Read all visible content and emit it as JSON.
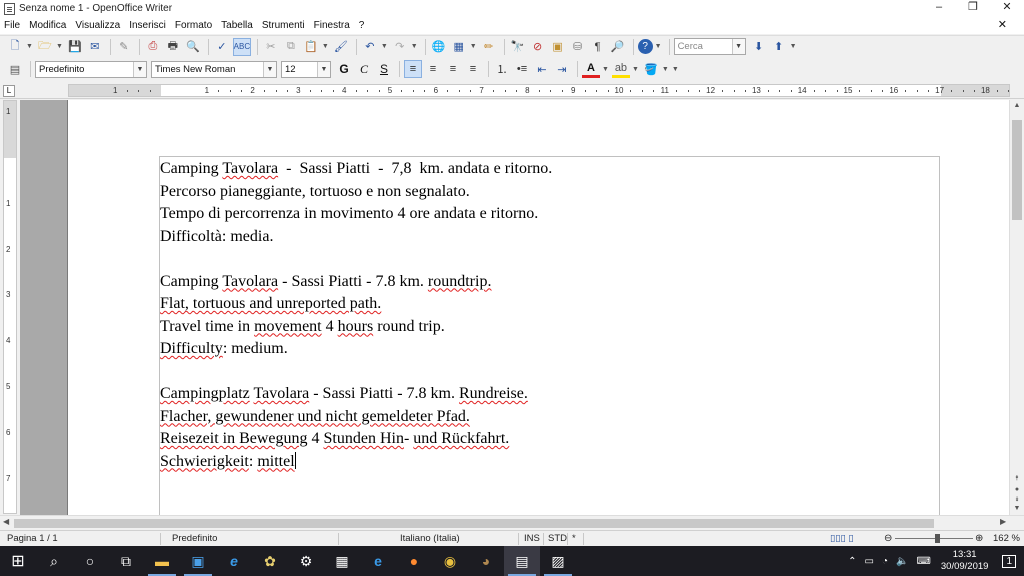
{
  "window": {
    "title": "Senza nome 1 - OpenOffice Writer",
    "minimize": "–",
    "maximize": "❐",
    "close": "✕"
  },
  "menu": [
    "File",
    "Modifica",
    "Visualizza",
    "Inserisci",
    "Formato",
    "Tabella",
    "Strumenti",
    "Finestra",
    "?"
  ],
  "toolbar": {
    "search_placeholder": "Cerca"
  },
  "formatting": {
    "style": "Predefinito",
    "font": "Times New Roman",
    "size": "12"
  },
  "ruler": {
    "h_ticks": [
      "1",
      "1",
      "2",
      "3",
      "4",
      "5",
      "6",
      "7",
      "8",
      "9",
      "10",
      "11",
      "12",
      "13",
      "14",
      "15",
      "16",
      "17",
      "18"
    ],
    "v_ticks": [
      "1",
      "1",
      "2",
      "3",
      "4",
      "5",
      "6",
      "7"
    ]
  },
  "document": {
    "lines": [
      [
        {
          "t": "Camping "
        },
        {
          "t": "Tavolara",
          "sp": true
        },
        {
          "t": "  -  Sassi Piatti  -  7,8  km. andata e ritorno."
        }
      ],
      [
        {
          "t": "Percorso pianeggiante, tortuoso e non segnalato."
        }
      ],
      [
        {
          "t": "Tempo di percorrenza in movimento 4 ore andata e ritorno."
        }
      ],
      [
        {
          "t": "Difficoltà: media."
        }
      ],
      [
        {
          "t": ""
        }
      ],
      [
        {
          "t": "Camping "
        },
        {
          "t": "Tavolara",
          "sp": true
        },
        {
          "t": " - Sassi Piatti - 7.8 km. "
        },
        {
          "t": "roundtrip.",
          "sp": true
        }
      ],
      [
        {
          "t": "Flat, tortuous and unreported path.",
          "sp": true
        }
      ],
      [
        {
          "t": "Travel time in "
        },
        {
          "t": "movement",
          "sp": true
        },
        {
          "t": " 4 "
        },
        {
          "t": "hours",
          "sp": true
        },
        {
          "t": " round trip."
        }
      ],
      [
        {
          "t": "Difficulty",
          "sp": true
        },
        {
          "t": ": medium."
        }
      ],
      [
        {
          "t": ""
        }
      ],
      [
        {
          "t": "Campingplatz",
          "sp": true
        },
        {
          "t": " "
        },
        {
          "t": "Tavolara",
          "sp": true
        },
        {
          "t": " - Sassi Piatti - 7.8 km. "
        },
        {
          "t": "Rundreise.",
          "sp": true
        }
      ],
      [
        {
          "t": "Flacher, gewundener und nicht gemeldeter Pfad.",
          "sp": true
        }
      ],
      [
        {
          "t": "Reisezeit in Bewegung",
          "sp": true
        },
        {
          "t": " 4 "
        },
        {
          "t": "Stunden Hin",
          "sp": true
        },
        {
          "t": "- "
        },
        {
          "t": "und Rückfahrt.",
          "sp": true
        }
      ],
      [
        {
          "t": "Schwierigkeit",
          "sp": true
        },
        {
          "t": ": "
        },
        {
          "t": "mittel",
          "sp": true
        }
      ]
    ]
  },
  "status": {
    "page": "Pagina 1 / 1",
    "style": "Predefinito",
    "language": "Italiano (Italia)",
    "ins": "INS",
    "std": "STD",
    "modified": "*",
    "zoom": "162 %"
  },
  "taskbar": {
    "time": "13:31",
    "date": "30/09/2019",
    "notifications": "1"
  },
  "colors": {
    "spellcheck_underline": "#e02020",
    "taskbar": "#1c1c22",
    "gray_area": "#a9a9a9"
  }
}
